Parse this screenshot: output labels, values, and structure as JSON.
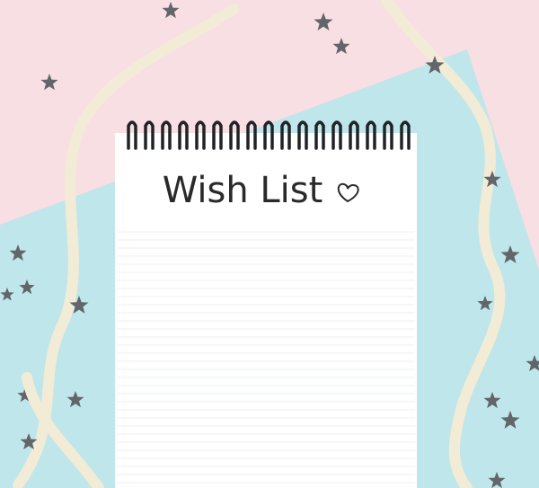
{
  "notepad": {
    "title": "Wish List",
    "heart_icon": "heart-icon",
    "ruled_line_color": "#e9ecef"
  },
  "palette": {
    "paper_pink": "#f7dfe3",
    "paper_blue": "#bfe6ea",
    "ribbon": "#f2ecd6",
    "star": "#626569",
    "spiral": "#202326"
  },
  "decor": {
    "ribbon_icon": "ribbon-icon",
    "star_icon": "star-icon"
  }
}
